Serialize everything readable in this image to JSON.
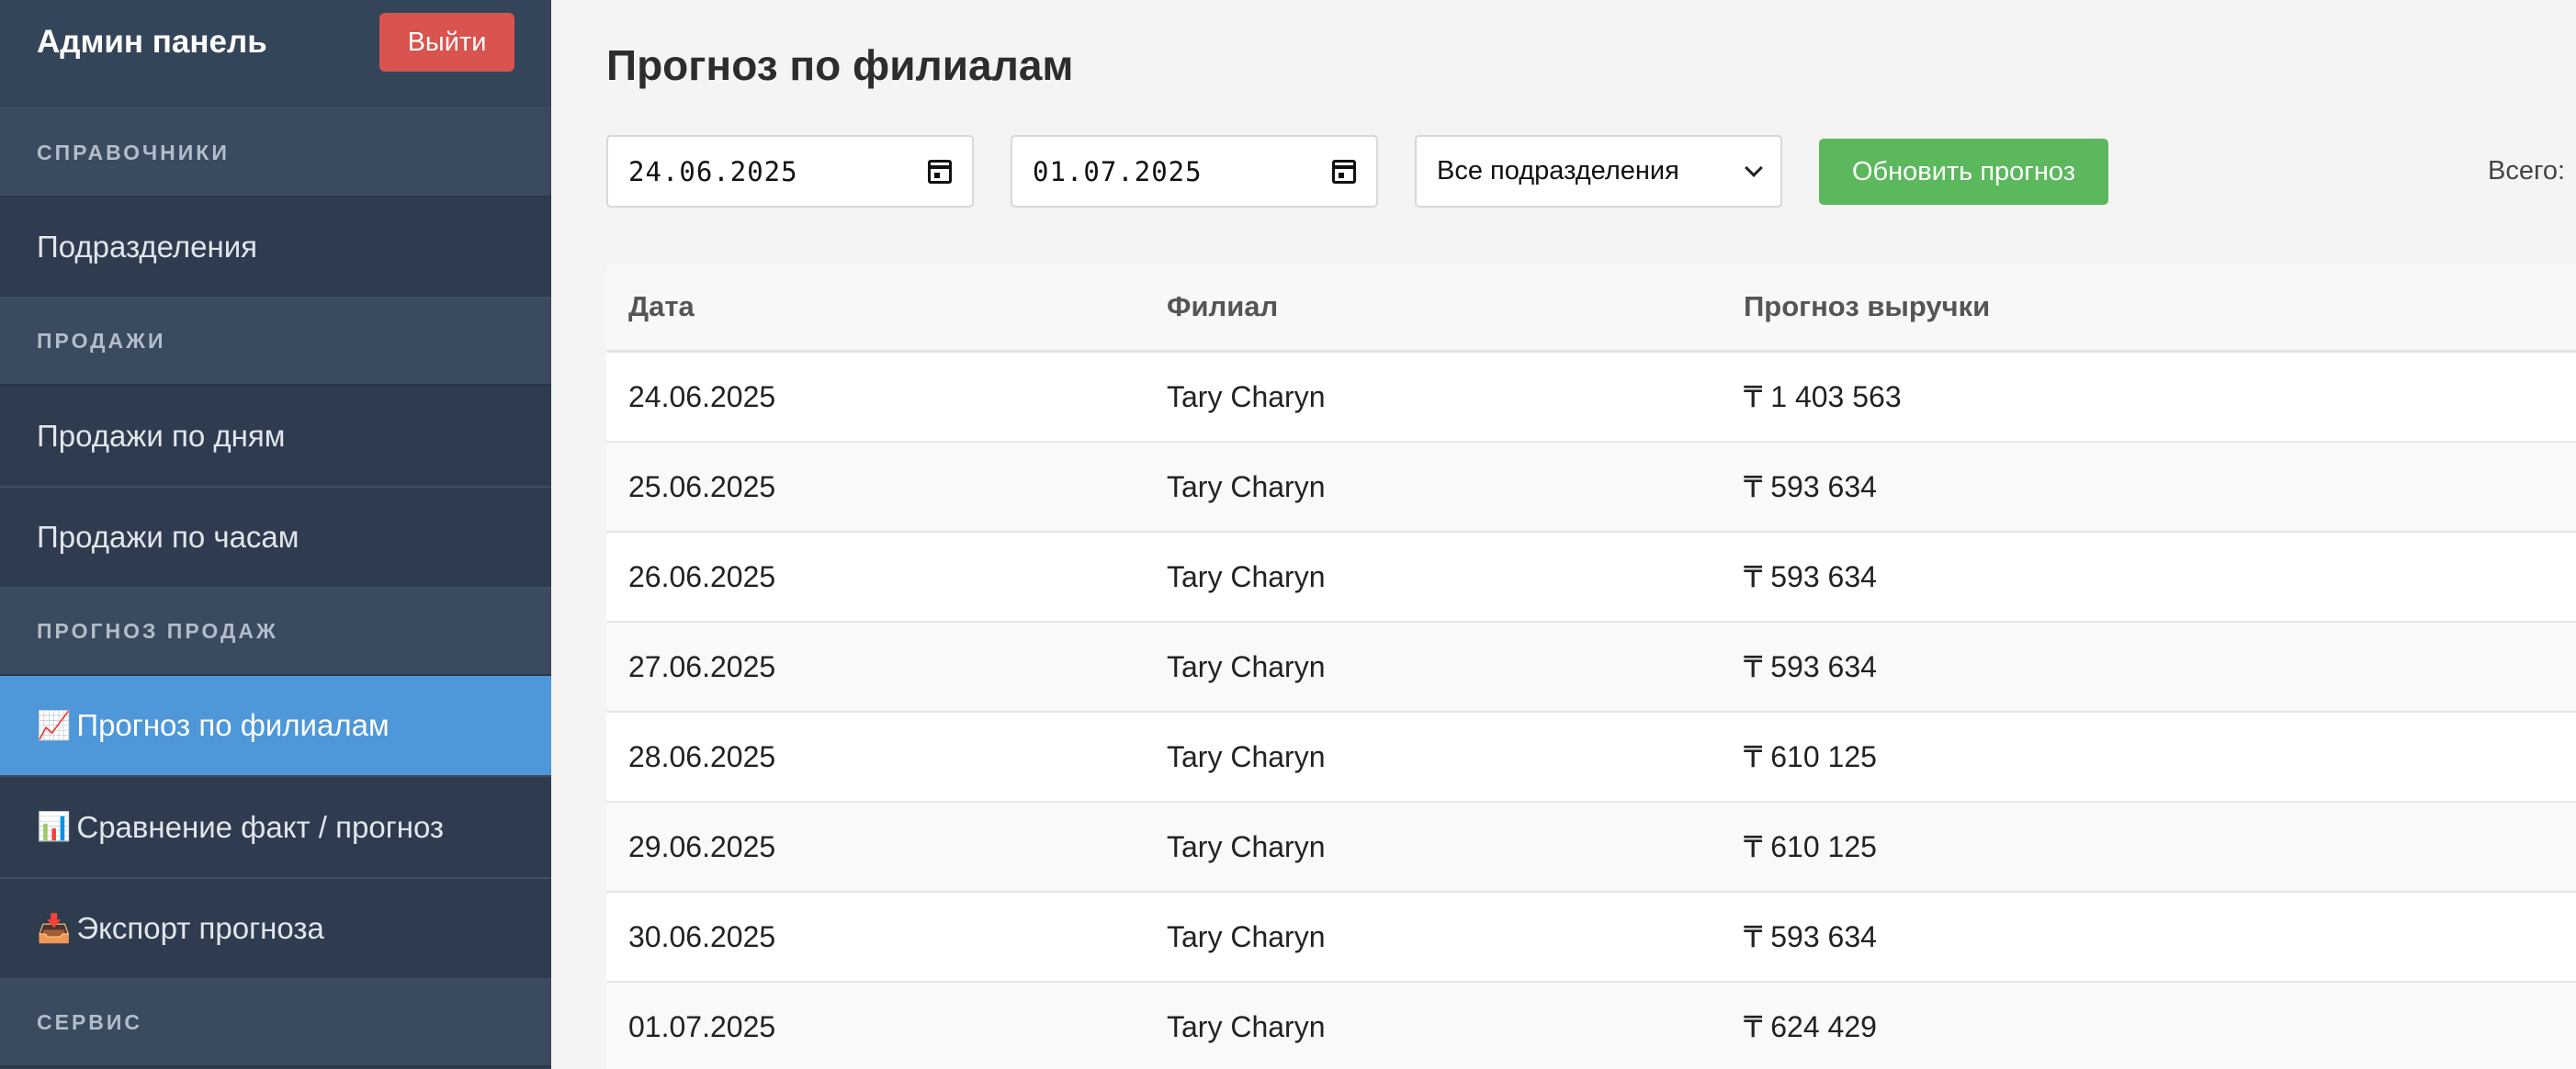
{
  "sidebar": {
    "title": "Админ панель",
    "logout_label": "Выйти",
    "sections": {
      "directories": "СПРАВОЧНИКИ",
      "sales": "ПРОДАЖИ",
      "forecast": "ПРОГНОЗ ПРОДАЖ",
      "service": "СЕРВИС"
    },
    "items": {
      "departments": "Подразделения",
      "sales_by_day": "Продажи по дням",
      "sales_by_hour": "Продажи по часам",
      "forecast_by_branch": "Прогноз по филиалам",
      "compare_fact_forecast": "Сравнение факт / прогноз",
      "export_forecast": "Экспорт прогноза"
    },
    "icons": {
      "forecast_by_branch": "📈",
      "compare_fact_forecast": "📊",
      "export_forecast": "📥"
    }
  },
  "main": {
    "title": "Прогноз по филиалам",
    "filters": {
      "date_from": "24.06.2025",
      "date_to": "01.07.2025",
      "department": "Все подразделения",
      "update_label": "Обновить прогноз",
      "total_label": "Всего:"
    },
    "table": {
      "headers": [
        "Дата",
        "Филиал",
        "Прогноз выручки"
      ],
      "rows": [
        [
          "24.06.2025",
          "Tary Charyn",
          "₸ 1 403 563"
        ],
        [
          "25.06.2025",
          "Tary Charyn",
          "₸ 593 634"
        ],
        [
          "26.06.2025",
          "Tary Charyn",
          "₸ 593 634"
        ],
        [
          "27.06.2025",
          "Tary Charyn",
          "₸ 593 634"
        ],
        [
          "28.06.2025",
          "Tary Charyn",
          "₸ 610 125"
        ],
        [
          "29.06.2025",
          "Tary Charyn",
          "₸ 610 125"
        ],
        [
          "30.06.2025",
          "Tary Charyn",
          "₸ 593 634"
        ],
        [
          "01.07.2025",
          "Tary Charyn",
          "₸ 624 429"
        ]
      ]
    }
  },
  "colors": {
    "sidebar_bg": "#2f3c4f",
    "active_item": "#4e97d8",
    "logout": "#d9534f",
    "update": "#5cb85c"
  }
}
